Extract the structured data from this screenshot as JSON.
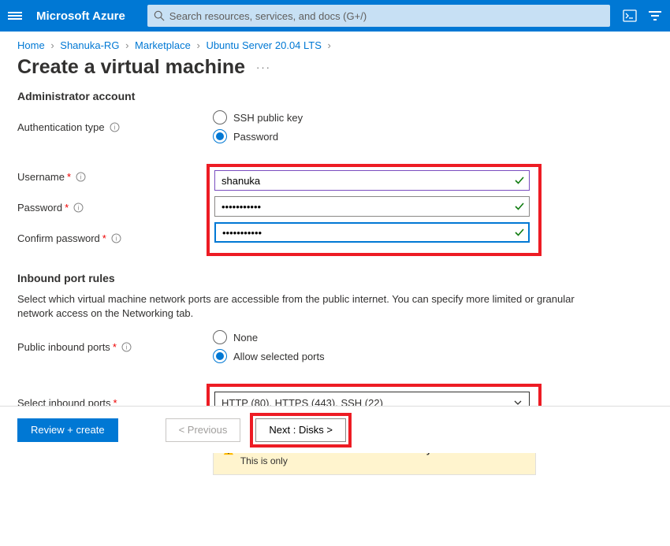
{
  "header": {
    "brand": "Microsoft Azure",
    "search_placeholder": "Search resources, services, and docs (G+/)"
  },
  "breadcrumb": {
    "items": [
      "Home",
      "Shanuka-RG",
      "Marketplace",
      "Ubuntu Server 20.04 LTS"
    ]
  },
  "page": {
    "title": "Create a virtual machine"
  },
  "admin": {
    "section_title": "Administrator account",
    "auth_type_label": "Authentication type",
    "auth_ssh": "SSH public key",
    "auth_password": "Password",
    "username_label": "Username",
    "username_value": "shanuka",
    "password_label": "Password",
    "password_value": "•••••••••••",
    "confirm_label": "Confirm password",
    "confirm_value": "•••••••••••"
  },
  "ports": {
    "section_title": "Inbound port rules",
    "desc": "Select which virtual machine network ports are accessible from the public internet. You can specify more limited or granular network access on the Networking tab.",
    "public_label": "Public inbound ports",
    "none": "None",
    "allow": "Allow selected ports",
    "select_label": "Select inbound ports",
    "select_value": "HTTP (80), HTTPS (443), SSH (22)",
    "warn_bold": "This will allow all IP addresses to access your virtual machine.",
    "warn_rest": "This is only"
  },
  "footer": {
    "review": "Review + create",
    "prev": "< Previous",
    "next": "Next : Disks >"
  }
}
